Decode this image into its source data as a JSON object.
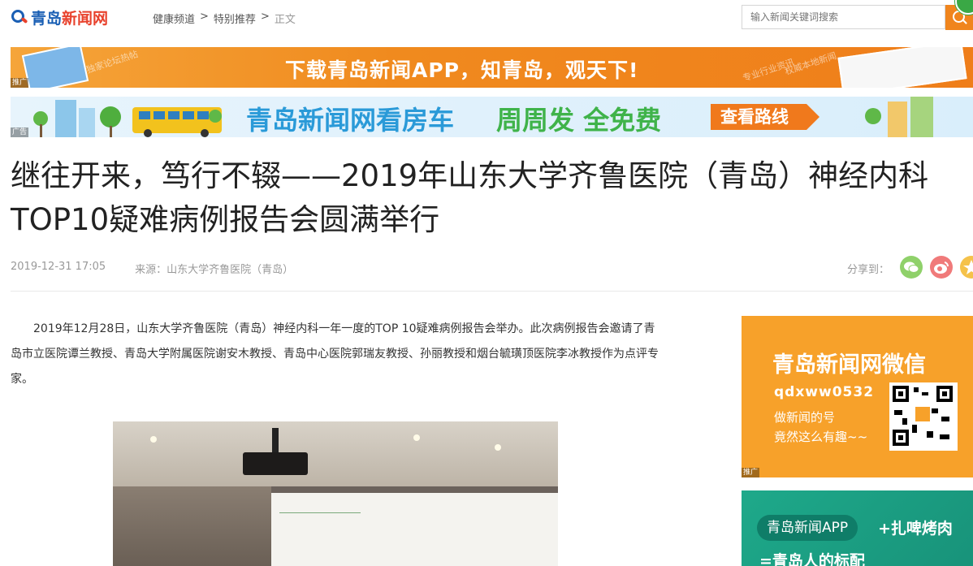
{
  "header": {
    "logo_part1": "青岛",
    "logo_part2": "新闻网",
    "breadcrumb": [
      "健康频道",
      ">",
      "特别推荐",
      ">",
      "正文"
    ],
    "search_placeholder": "输入新闻关键词搜索"
  },
  "banner1": {
    "text": "下载青岛新闻APP，知青岛，观天下!",
    "side_left": "独家论坛热帖",
    "side_right1": "专业行业资讯",
    "side_right2": "权威本地新闻",
    "tag": "推广"
  },
  "banner2": {
    "text_blue": "青岛新闻网看房车",
    "text_green": "周周发  全免费",
    "button": "查看路线",
    "tag": "广告"
  },
  "article": {
    "title": "继往开来，笃行不辍——2019年山东大学齐鲁医院（青岛）神经内科TOP10疑难病例报告会圆满举行",
    "date": "2019-12-31 17:05",
    "source": "来源：山东大学齐鲁医院（青岛）",
    "share_label": "分享到：",
    "paragraph": "2019年12月28日，山东大学齐鲁医院（青岛）神经内科一年一度的TOP 10疑难病例报告会举办。此次病例报告会邀请了青岛市立医院谭兰教授、青岛大学附属医院谢安木教授、青岛中心医院郭瑞友教授、孙丽教授和烟台毓璜顶医院李冰教授作为点评专家。"
  },
  "sidebar": {
    "wechat": {
      "title": "青岛新闻网微信",
      "id": "qdxww0532",
      "line1": "做新闻的号",
      "line2": "竟然这么有趣~~",
      "tag": "推广"
    },
    "app": {
      "pill": "青岛新闻APP",
      "text": "+扎啤烤肉",
      "text2": "=青岛人的标配"
    }
  },
  "colors": {
    "brand_blue": "#1a5fb4",
    "brand_red": "#e8412c",
    "accent_orange": "#f0851d"
  }
}
